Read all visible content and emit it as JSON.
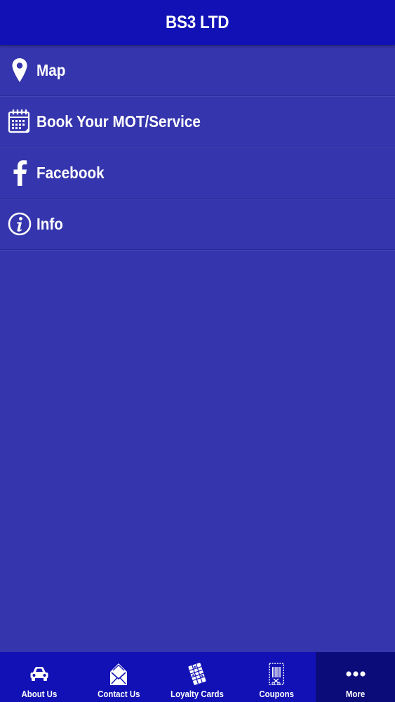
{
  "header": {
    "title": "BS3 LTD"
  },
  "menu": {
    "items": [
      {
        "label": "Map",
        "icon": "map-pin-icon"
      },
      {
        "label": "Book Your MOT/Service",
        "icon": "calendar-icon"
      },
      {
        "label": "Facebook",
        "icon": "facebook-icon"
      },
      {
        "label": "Info",
        "icon": "info-icon"
      }
    ]
  },
  "tabbar": {
    "tabs": [
      {
        "label": "About Us",
        "icon": "car-icon"
      },
      {
        "label": "Contact Us",
        "icon": "envelope-icon"
      },
      {
        "label": "Loyalty Cards",
        "icon": "loyalty-card-icon"
      },
      {
        "label": "Coupons",
        "icon": "coupon-icon"
      },
      {
        "label": "More",
        "icon": "more-dots-icon",
        "active": true
      }
    ]
  },
  "colors": {
    "background": "#3535ad",
    "header": "#1111b5",
    "tabbar": "#1111b5",
    "active_tab": "#0b0b7a",
    "text": "#ffffff"
  }
}
